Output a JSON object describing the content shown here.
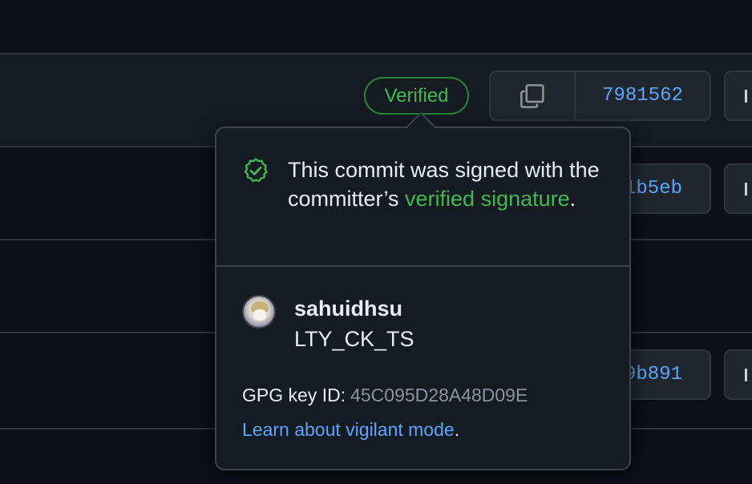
{
  "commits": [
    {
      "sha": "7981562",
      "badge": "Verified"
    },
    {
      "sha_visible": "1b5eb"
    },
    {
      "sha_visible": "9b891"
    }
  ],
  "icons": {
    "copy": "copy-icon",
    "browse": "chevron-right-icon",
    "verified": "shield-check-icon"
  },
  "popover": {
    "message_prefix": "This commit was signed with the committer’s ",
    "message_link": "verified signature",
    "message_suffix": ".",
    "user": {
      "login": "sahuidhsu",
      "name": "LTY_CK_TS"
    },
    "gpg_label": "GPG key ID:",
    "gpg_key": "45C095D28A48D09E",
    "learn_link": "Learn about vigilant mode",
    "learn_suffix": "."
  },
  "colors": {
    "background": "#0d1117",
    "verified_green": "#3fb950",
    "link_blue": "#58a6ff",
    "border": "#30363d"
  }
}
